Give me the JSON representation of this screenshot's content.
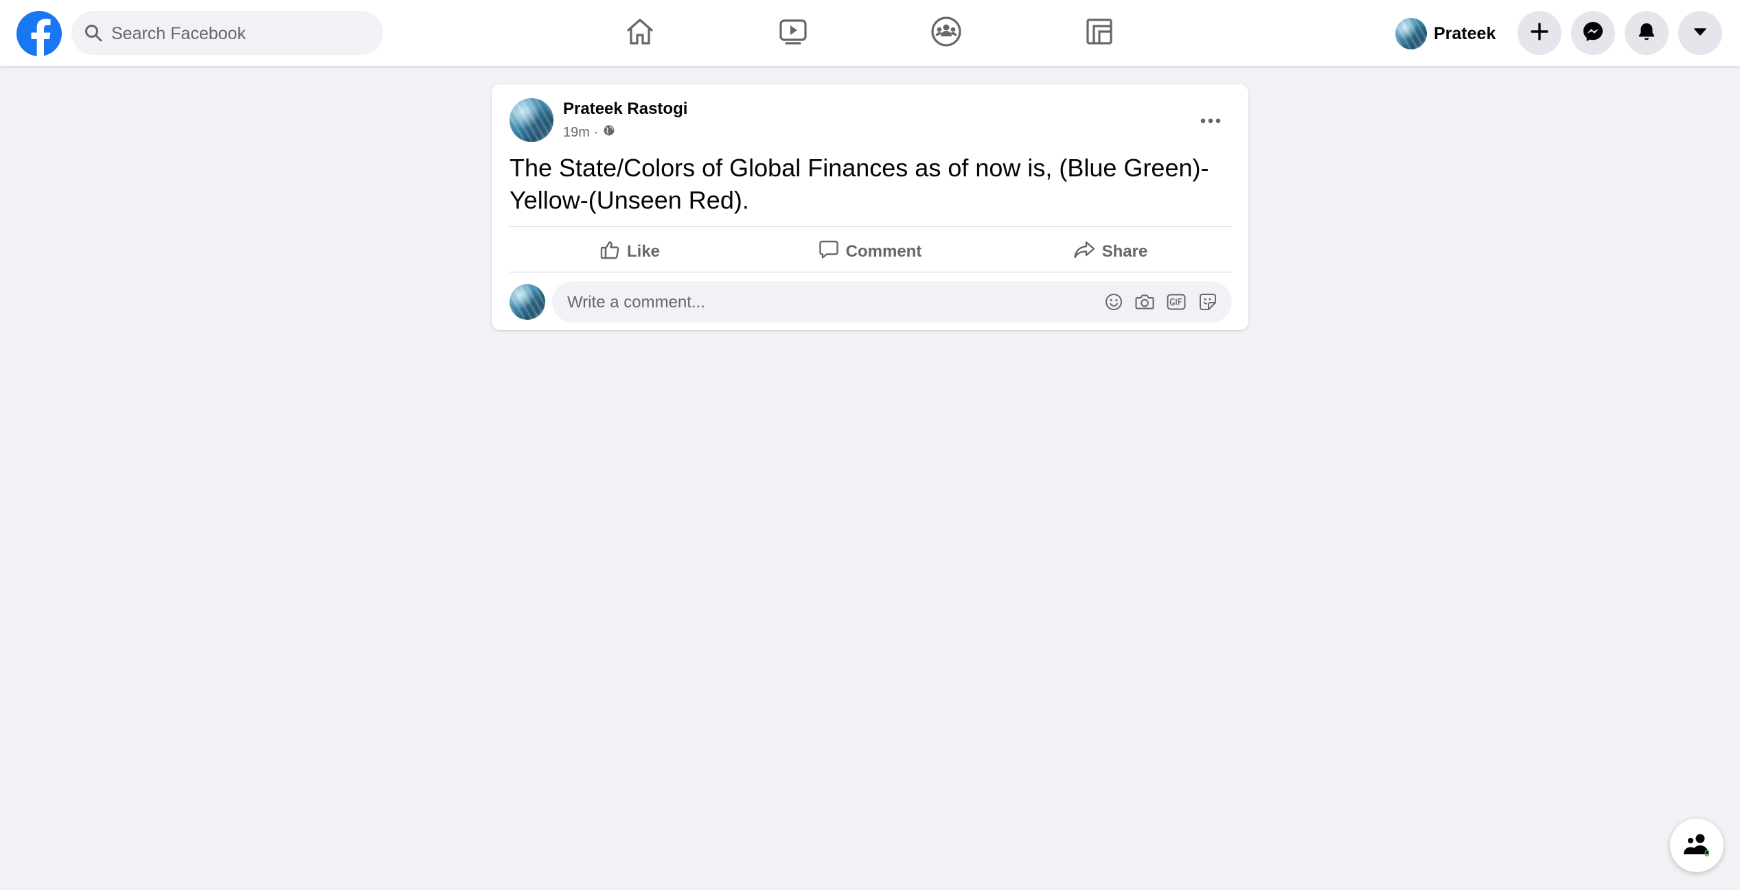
{
  "topbar": {
    "search_placeholder": "Search Facebook",
    "nav": [
      "home-icon",
      "watch-icon",
      "groups-icon",
      "gaming-icon"
    ],
    "profile_name": "Prateek",
    "buttons": [
      "plus-icon",
      "messenger-icon",
      "notifications-bell-icon",
      "account-caret-icon"
    ]
  },
  "post": {
    "author": "Prateek Rastogi",
    "time": "19m",
    "separator": "·",
    "audience_icon": "globe-icon",
    "text": "The State/Colors of Global Finances as of now is, (Blue Green)-Yellow-(Unseen Red).",
    "actions": {
      "like": "Like",
      "comment": "Comment",
      "share": "Share"
    },
    "comment_placeholder": "Write a comment...",
    "comment_icons": [
      "emoji-icon",
      "camera-icon",
      "gif-icon",
      "sticker-icon"
    ]
  },
  "contacts": {
    "count": "0"
  },
  "colors": {
    "brand": "#1877f2",
    "background": "#f0f2f5",
    "muted_text": "#65676b",
    "online": "#31a24c"
  }
}
